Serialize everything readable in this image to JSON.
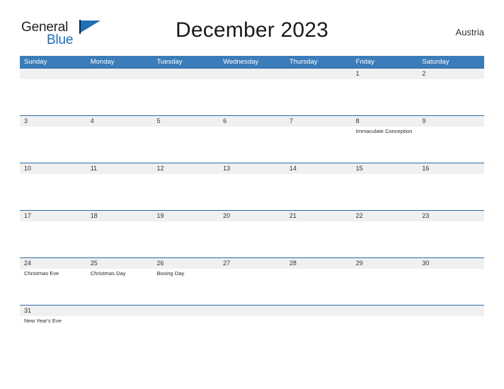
{
  "brand": {
    "name_part1": "General",
    "name_part2": "Blue",
    "flag_icon": "blue-flag-triangle"
  },
  "header": {
    "title": "December 2023",
    "locale": "Austria"
  },
  "calendar": {
    "month": "December",
    "year": "2023",
    "colors": {
      "header_blue": "#3b7cba",
      "row_line_blue": "#2c6ca8",
      "number_band_gray": "#f0f0f0",
      "brand_blue": "#1f6fb5",
      "text_dark": "#333333"
    },
    "day_headers": [
      "Sunday",
      "Monday",
      "Tuesday",
      "Wednesday",
      "Thursday",
      "Friday",
      "Saturday"
    ],
    "weeks": [
      [
        {
          "date": "",
          "event": ""
        },
        {
          "date": "",
          "event": ""
        },
        {
          "date": "",
          "event": ""
        },
        {
          "date": "",
          "event": ""
        },
        {
          "date": "",
          "event": ""
        },
        {
          "date": "1",
          "event": ""
        },
        {
          "date": "2",
          "event": ""
        }
      ],
      [
        {
          "date": "3",
          "event": ""
        },
        {
          "date": "4",
          "event": ""
        },
        {
          "date": "5",
          "event": ""
        },
        {
          "date": "6",
          "event": ""
        },
        {
          "date": "7",
          "event": ""
        },
        {
          "date": "8",
          "event": "Immaculate Conception"
        },
        {
          "date": "9",
          "event": ""
        }
      ],
      [
        {
          "date": "10",
          "event": ""
        },
        {
          "date": "11",
          "event": ""
        },
        {
          "date": "12",
          "event": ""
        },
        {
          "date": "13",
          "event": ""
        },
        {
          "date": "14",
          "event": ""
        },
        {
          "date": "15",
          "event": ""
        },
        {
          "date": "16",
          "event": ""
        }
      ],
      [
        {
          "date": "17",
          "event": ""
        },
        {
          "date": "18",
          "event": ""
        },
        {
          "date": "19",
          "event": ""
        },
        {
          "date": "20",
          "event": ""
        },
        {
          "date": "21",
          "event": ""
        },
        {
          "date": "22",
          "event": ""
        },
        {
          "date": "23",
          "event": ""
        }
      ],
      [
        {
          "date": "24",
          "event": "Christmas Eve"
        },
        {
          "date": "25",
          "event": "Christmas Day"
        },
        {
          "date": "26",
          "event": "Boxing Day"
        },
        {
          "date": "27",
          "event": ""
        },
        {
          "date": "28",
          "event": ""
        },
        {
          "date": "29",
          "event": ""
        },
        {
          "date": "30",
          "event": ""
        }
      ],
      [
        {
          "date": "31",
          "event": "New Year's Eve"
        },
        {
          "date": "",
          "event": ""
        },
        {
          "date": "",
          "event": ""
        },
        {
          "date": "",
          "event": ""
        },
        {
          "date": "",
          "event": ""
        },
        {
          "date": "",
          "event": ""
        },
        {
          "date": "",
          "event": ""
        }
      ]
    ]
  }
}
